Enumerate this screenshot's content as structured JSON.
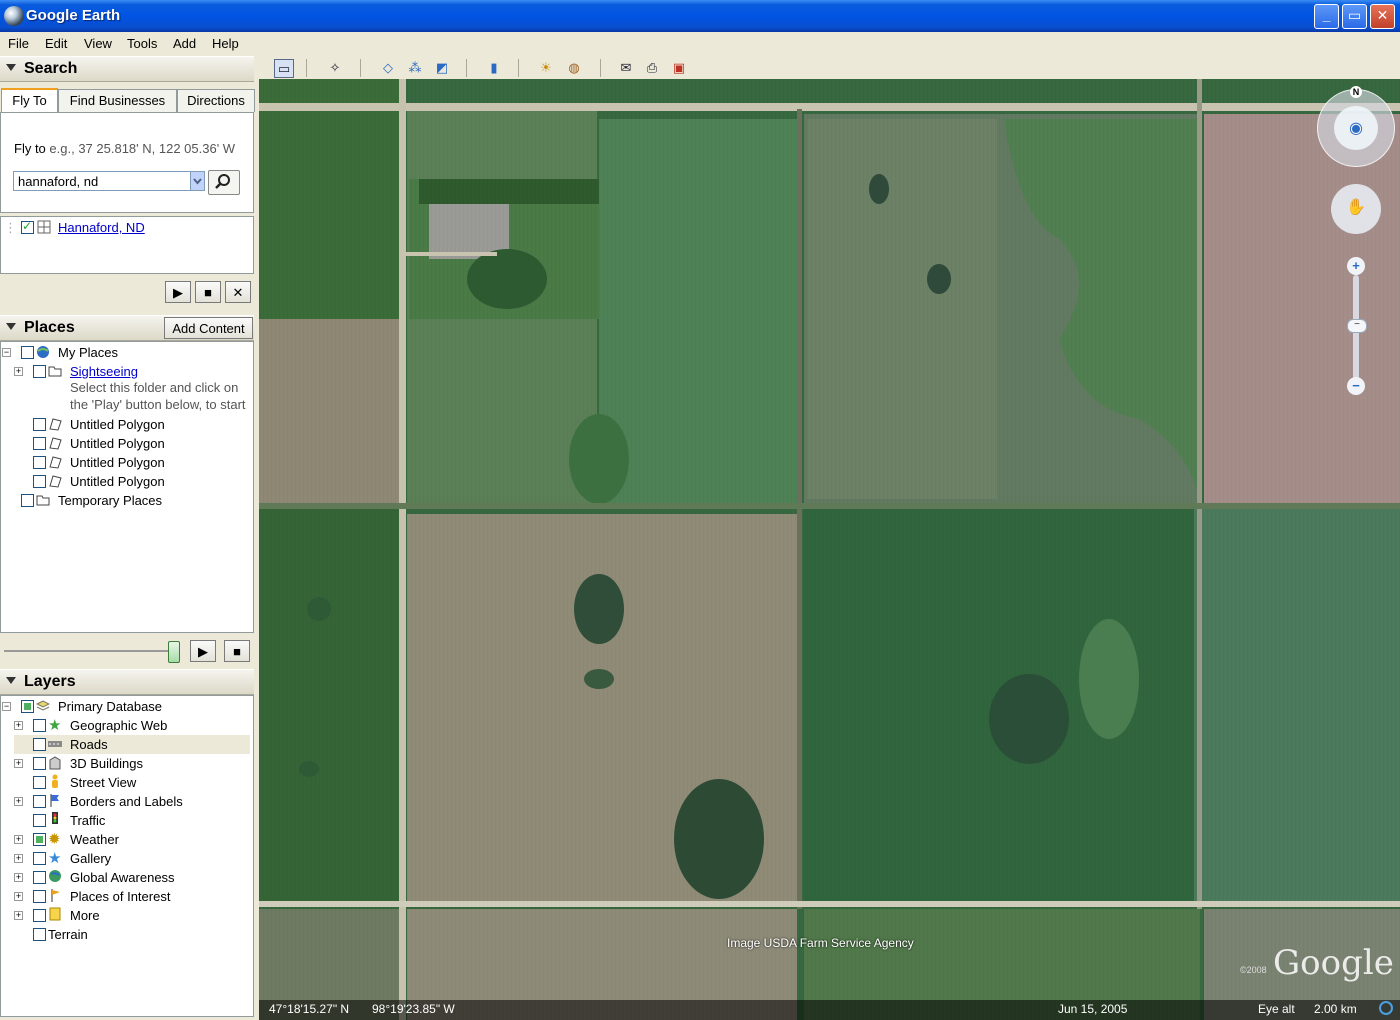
{
  "window": {
    "title": "Google Earth",
    "minimize": "_",
    "maximize": "▭",
    "close": "✕"
  },
  "menu": [
    "File",
    "Edit",
    "View",
    "Tools",
    "Add",
    "Help"
  ],
  "search": {
    "header": "Search",
    "tabs": [
      "Fly To",
      "Find Businesses",
      "Directions"
    ],
    "fly_label": "Fly to",
    "fly_hint": "e.g., 37 25.818' N, 122 05.36' W",
    "query": "hannaford, nd",
    "result": "Hannaford, ND"
  },
  "places": {
    "header": "Places",
    "add_content": "Add Content",
    "my_places": "My Places",
    "sightseeing": "Sightseeing",
    "hint_line1": "Select this folder and click on",
    "hint_line2": "the 'Play' button below, to start",
    "polygons": [
      "Untitled Polygon",
      "Untitled Polygon",
      "Untitled Polygon",
      "Untitled Polygon"
    ],
    "temporary": "Temporary Places"
  },
  "layers": {
    "header": "Layers",
    "primary": "Primary Database",
    "items": [
      "Geographic Web",
      "Roads",
      "3D Buildings",
      "Street View",
      "Borders and Labels",
      "Traffic",
      "Weather",
      "Gallery",
      "Global Awareness",
      "Places of Interest",
      "More"
    ],
    "terrain": "Terrain"
  },
  "map": {
    "attribution": "Image USDA Farm Service Agency",
    "copyright": "©2008",
    "brand": "Google",
    "north": "N",
    "latitude": "47°18'15.27\" N",
    "longitude": "98°19'23.85\" W",
    "date": "Jun 15, 2005",
    "eye_alt_label": "Eye alt",
    "eye_alt_value": "2.00 km"
  },
  "colors": {
    "title_bar": "#0054e3",
    "chrome": "#ece9d8",
    "link": "#0000cc",
    "field_green": "#3a6b45"
  }
}
